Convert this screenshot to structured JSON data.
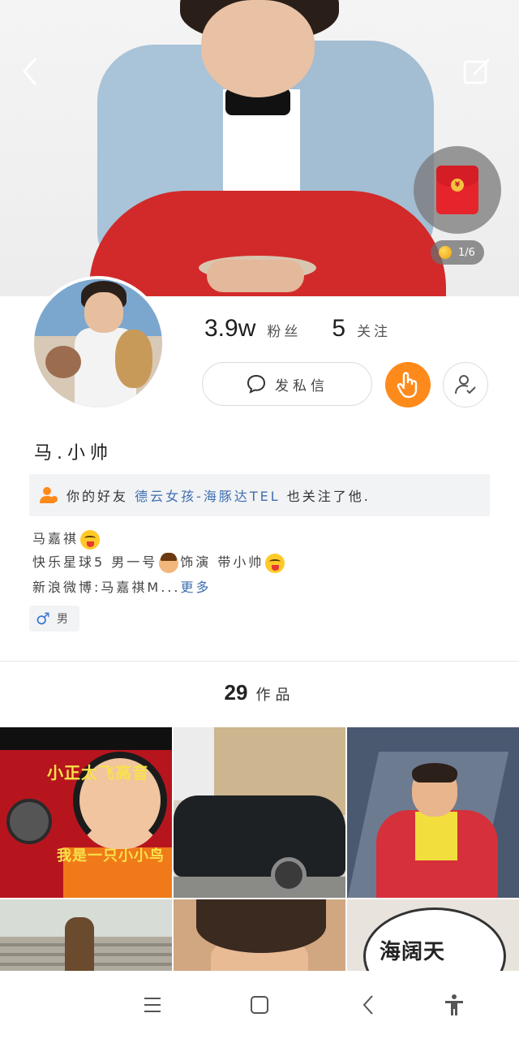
{
  "cover": {
    "coin_count": "1/6"
  },
  "profile": {
    "followers_count": "3.9w",
    "followers_label": "粉丝",
    "following_count": "5",
    "following_label": "关注",
    "message_button": "发私信",
    "name": "马.小帅"
  },
  "friend_notice": {
    "prefix": "你的好友",
    "friend_name": "德云女孩-海豚达TEL",
    "suffix": "也关注了他."
  },
  "bio": {
    "line1": "马嘉祺",
    "line2_a": "快乐星球5 男一号",
    "line2_b": "饰演 带小帅",
    "line3": "新浪微博:马嘉祺M...",
    "more": "更多"
  },
  "gender": {
    "symbol": "♂",
    "label": "男"
  },
  "works": {
    "count": "29",
    "label": "作品"
  },
  "thumbnails": [
    {
      "caption_top": "小正太飞高音",
      "caption_bottom": "我是一只小小鸟"
    },
    {},
    {},
    {},
    {},
    {
      "caption": "海阔天"
    }
  ],
  "colors": {
    "accent": "#ff8a1c",
    "link": "#3f6fb0",
    "gender": "#3a78d6"
  },
  "icons": [
    "back-arrow-icon",
    "edit-icon",
    "loading-icon",
    "red-packet-icon",
    "coin-icon",
    "chat-bubble-icon",
    "hand-tap-icon",
    "user-check-icon",
    "friend-icon",
    "menu-icon",
    "home-square-icon",
    "nav-back-icon",
    "accessibility-icon"
  ]
}
